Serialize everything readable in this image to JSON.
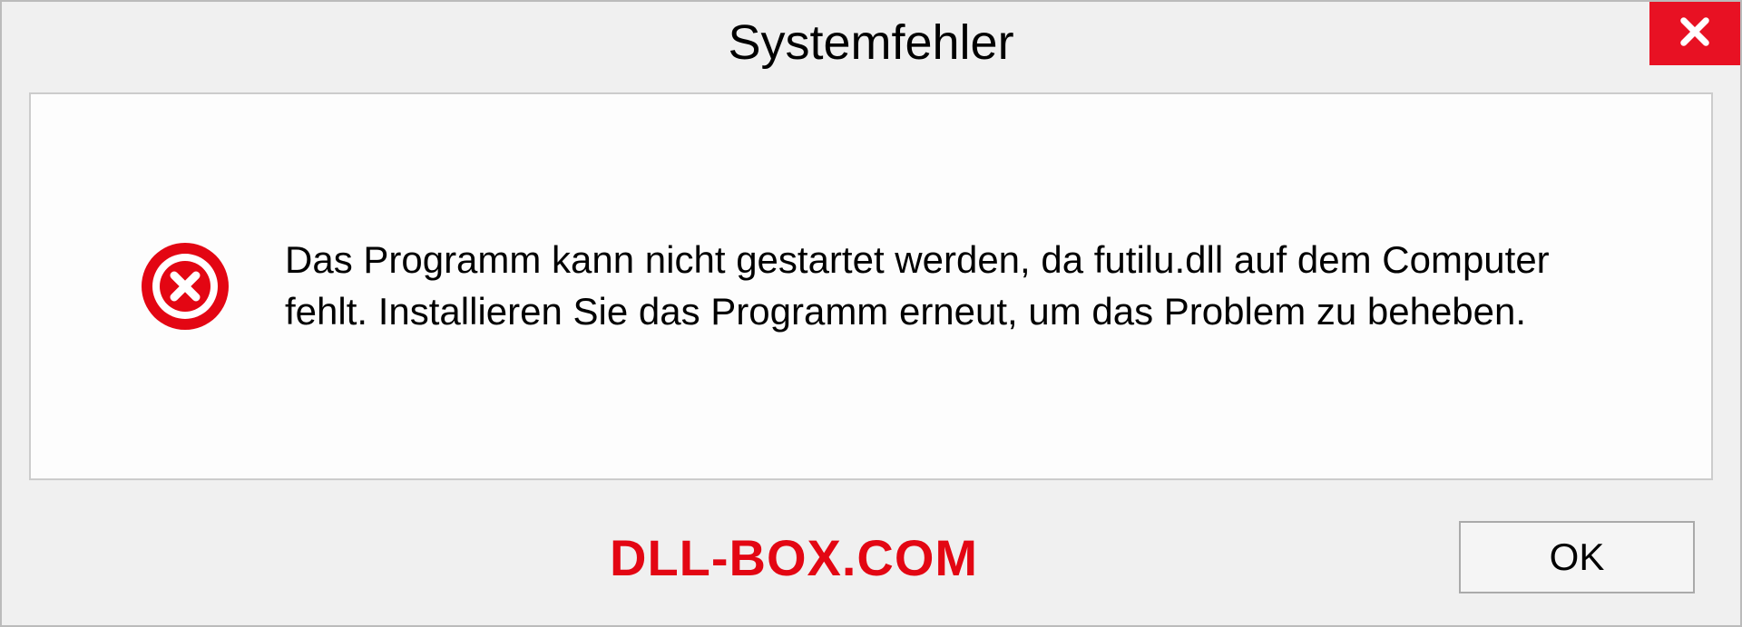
{
  "titlebar": {
    "title": "Systemfehler"
  },
  "content": {
    "message": "Das Programm kann nicht gestartet werden, da futilu.dll auf dem Computer fehlt. Installieren Sie das Programm erneut, um das Problem zu beheben."
  },
  "footer": {
    "watermark": "DLL-BOX.COM",
    "ok_label": "OK"
  },
  "colors": {
    "close_button": "#e81123",
    "error_icon": "#e30613",
    "watermark": "#e30613"
  }
}
